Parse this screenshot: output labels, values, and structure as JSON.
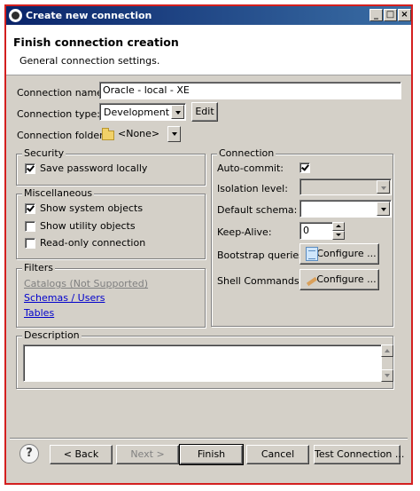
{
  "window": {
    "title": "Create new connection"
  },
  "header": {
    "title": "Finish connection creation",
    "subtitle": "General connection settings."
  },
  "form": {
    "name_label": "Connection name:",
    "name_value": "Oracle - local - XE",
    "type_label": "Connection type:",
    "type_value": "Development",
    "edit_label": "Edit",
    "folder_label": "Connection folder:",
    "folder_value": "<None>"
  },
  "security": {
    "title": "Security",
    "save_password": {
      "label": "Save password locally",
      "checked": true
    }
  },
  "misc": {
    "title": "Miscellaneous",
    "items": [
      {
        "label": "Show system objects",
        "checked": true
      },
      {
        "label": "Show utility objects",
        "checked": false
      },
      {
        "label": "Read-only connection",
        "checked": false
      }
    ]
  },
  "filters": {
    "title": "Filters",
    "links": [
      "Catalogs (Not Supported)",
      "Schemas / Users",
      "Tables"
    ]
  },
  "connection": {
    "title": "Connection",
    "autocommit_label": "Auto-commit:",
    "autocommit_checked": true,
    "isolation_label": "Isolation level:",
    "schema_label": "Default schema:",
    "keepalive_label": "Keep-Alive:",
    "keepalive_value": "0",
    "bootstrap_label": "Bootstrap queries:",
    "shell_label": "Shell Commands:",
    "configure_label": "Configure ..."
  },
  "description": {
    "title": "Description"
  },
  "footer": {
    "back": "< Back",
    "next": "Next >",
    "finish": "Finish",
    "cancel": "Cancel",
    "test": "Test Connection ..."
  }
}
